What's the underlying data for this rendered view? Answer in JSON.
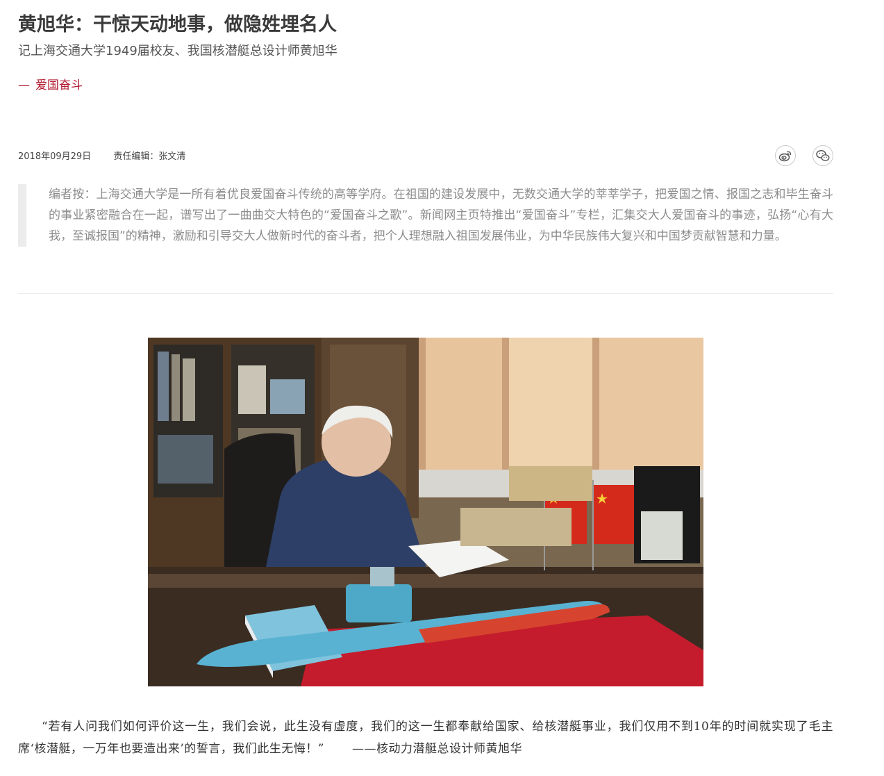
{
  "article": {
    "title": "黄旭华：干惊天动地事，做隐姓埋名人",
    "subtitle": "记上海交通大学1949届校友、我国核潜艇总设计师黄旭华",
    "column": {
      "dash": "—",
      "name": "爱国奋斗"
    },
    "meta": {
      "date": "2018年09月29日",
      "editor": "责任编辑：张文清"
    },
    "share": {
      "weibo_icon": "weibo-icon",
      "wechat_icon": "wechat-icon"
    },
    "editor_note": "编者按：上海交通大学是一所有着优良爱国奋斗传统的高等学府。在祖国的建设发展中，无数交通大学的莘莘学子，把爱国之情、报国之志和毕生奋斗的事业紧密融合在一起，谱写出了一曲曲交大特色的“爱国奋斗之歌”。新闻网主页特推出“爱国奋斗”专栏，汇集交大人爱国奋斗的事迹，弘扬“心有大我，至诚报国”的精神，激励和引导交大人做新时代的奋斗者，把个人理想融入祖国发展伟业，为中华民族伟大复兴和中国梦贡献智慧和力量。",
    "quote": {
      "text": "“若有人问我们如何评价这一生，我们会说，此生没有虚度，我们的这一生都奉献给国家、给核潜艇事业，我们仅用不到10年的时间就实现了毛主席‘核潜艇，一万年也要造出来’的誓言，我们此生无悔！”",
      "attribution": "——核动力潜艇总设计师黄旭华"
    }
  },
  "colors": {
    "accent": "#b1172d",
    "note_text": "#8c8c8c",
    "note_bar": "#ececec"
  }
}
